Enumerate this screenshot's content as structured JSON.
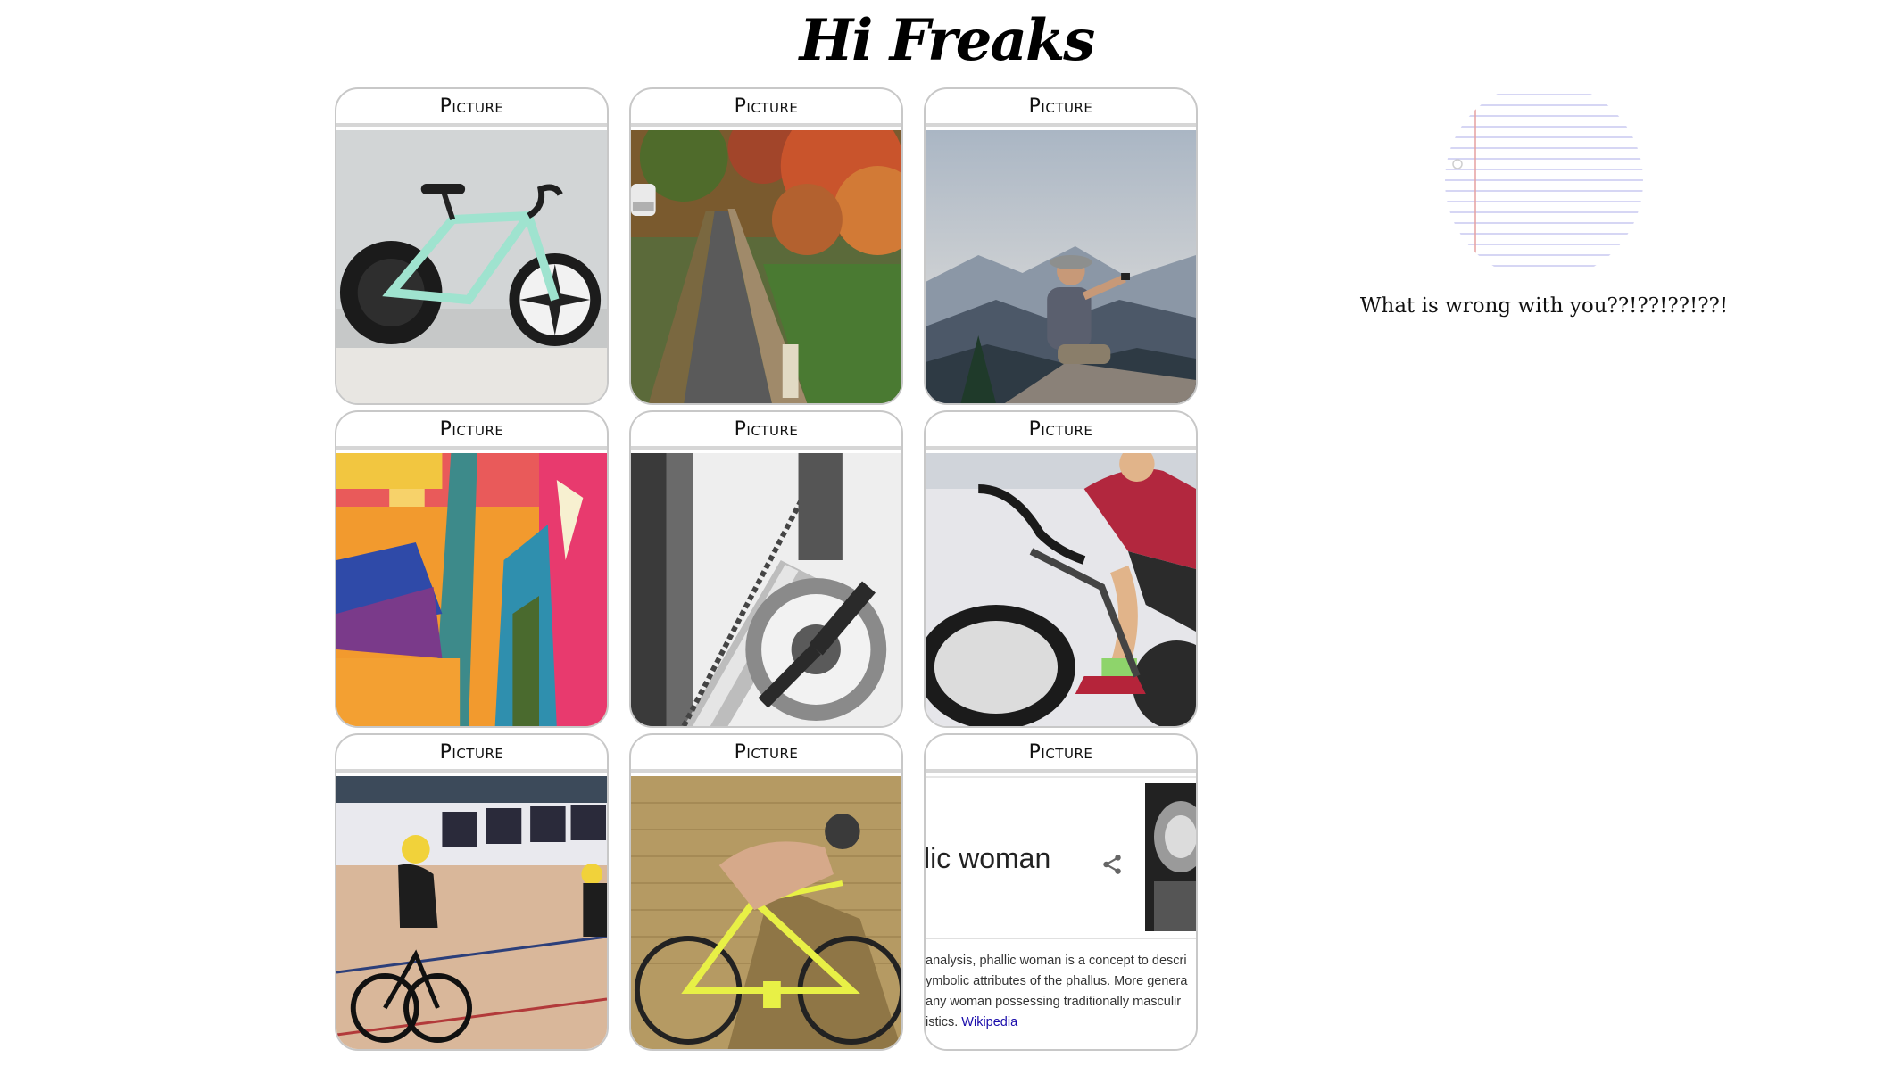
{
  "header": {
    "title": "Hi Freaks"
  },
  "cards": [
    {
      "label": "Picture",
      "image": "fixed-gear bicycle against a wall"
    },
    {
      "label": "Picture",
      "image": "autumn forest road"
    },
    {
      "label": "Picture",
      "image": "hiker taking selfie on mountain"
    },
    {
      "label": "Picture",
      "image": "abstract colorful painting"
    },
    {
      "label": "Picture",
      "image": "bicycle crankset and chain close-up"
    },
    {
      "label": "Picture",
      "image": "track cyclist leaning into turn"
    },
    {
      "label": "Picture",
      "image": "track cyclists racing in velodrome"
    },
    {
      "label": "Picture",
      "image": "cyclist on yellow fixed gear bike"
    },
    {
      "label": "Picture",
      "image": "search result snippet"
    }
  ],
  "wiki_card": {
    "title": "lic woman",
    "lines": [
      "analysis, phallic woman is a concept to descri",
      "ymbolic attributes of the phallus. More genera",
      " any woman possessing traditionally masculir",
      "istics. "
    ],
    "link": "Wikipedia"
  },
  "sidebar": {
    "caption": "What is wrong with you??!??!??!??!"
  },
  "colors": {
    "card_border": "#c8c8c8",
    "link": "#1a0dab"
  }
}
